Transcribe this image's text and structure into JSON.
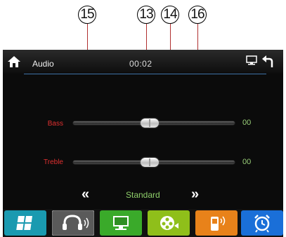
{
  "callouts": [
    "15",
    "13",
    "14",
    "16"
  ],
  "header": {
    "title": "Audio",
    "time": "00:02"
  },
  "sliders": [
    {
      "label": "Bass",
      "value_text": "00",
      "level": 0.5
    },
    {
      "label": "Treble",
      "value_text": "00",
      "level": 0.5
    }
  ],
  "preset": {
    "name": "Standard",
    "prev_symbol": "«",
    "next_symbol": "»"
  },
  "bottom_tabs": [
    {
      "icon": "windows-icon",
      "color": "#1a9ab0"
    },
    {
      "icon": "headphones-icon",
      "color": "#5a5a5a",
      "active": true
    },
    {
      "icon": "monitor-icon",
      "color": "#3aaa2a"
    },
    {
      "icon": "video-reel-icon",
      "color": "#8fbf1a"
    },
    {
      "icon": "phone-bluetooth-icon",
      "color": "#e8821a"
    },
    {
      "icon": "alarm-clock-icon",
      "color": "#1a6fd8"
    }
  ],
  "colors": {
    "label": "#e03030",
    "value": "#9bd07a",
    "accent_line": "#3f73a8"
  }
}
